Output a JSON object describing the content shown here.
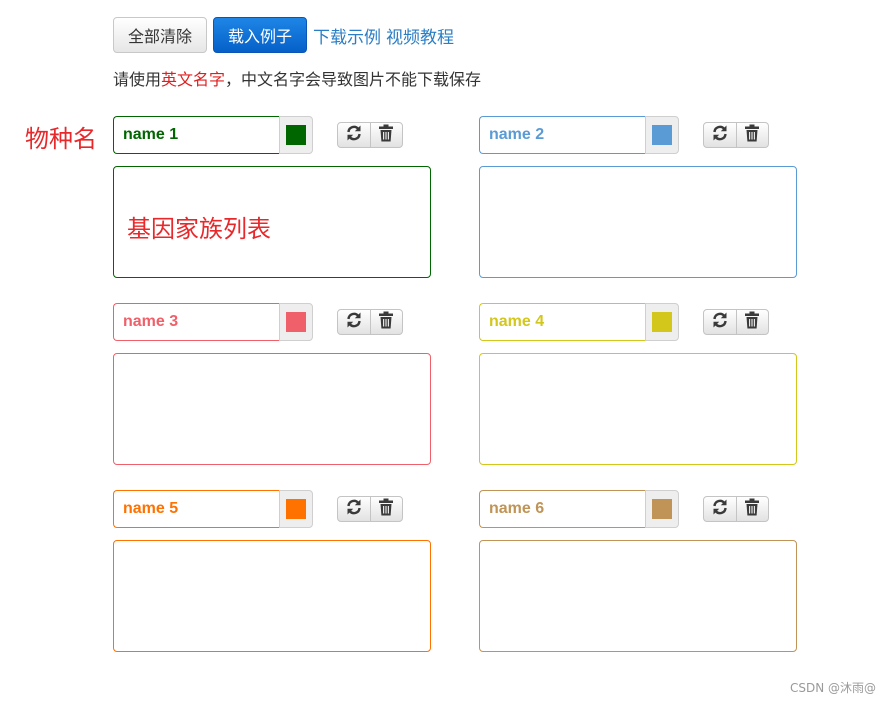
{
  "toolbar": {
    "clear_all_label": "全部清除",
    "load_example_label": "载入例子",
    "download_example_label": "下载示例",
    "video_tutorial_label": "视频教程"
  },
  "hint": {
    "prefix": "请使用",
    "highlight": "英文名字",
    "suffix": "，中文名字会导致图片不能下载保存"
  },
  "annotations": {
    "species_name_label": "物种名",
    "gene_family_label": "基因家族列表"
  },
  "species": [
    {
      "name": "name 1",
      "color": "#006600",
      "genes": ""
    },
    {
      "name": "name 2",
      "color": "#5b9bd5",
      "genes": ""
    },
    {
      "name": "name 3",
      "color": "#f0606a",
      "genes": ""
    },
    {
      "name": "name 4",
      "color": "#d4c71c",
      "genes": ""
    },
    {
      "name": "name 5",
      "color": "#ff7200",
      "genes": ""
    },
    {
      "name": "name 6",
      "color": "#c09456",
      "genes": ""
    }
  ],
  "icons": {
    "refresh": "refresh-icon",
    "delete": "trash-icon"
  },
  "watermark": "CSDN @沐雨@"
}
